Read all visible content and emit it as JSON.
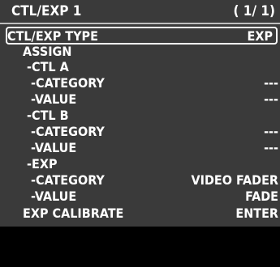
{
  "header": {
    "title": "CTL/EXP 1",
    "page": "( 1/ 1)"
  },
  "rows": [
    {
      "label": "CTL/EXP TYPE",
      "value": "EXP"
    },
    {
      "label": "ASSIGN",
      "value": ""
    },
    {
      "label": " -CTL A",
      "value": ""
    },
    {
      "label": "  -CATEGORY",
      "value": "---"
    },
    {
      "label": "  -VALUE",
      "value": "---"
    },
    {
      "label": " -CTL B",
      "value": ""
    },
    {
      "label": "  -CATEGORY",
      "value": "---"
    },
    {
      "label": "  -VALUE",
      "value": "---"
    },
    {
      "label": " -EXP",
      "value": ""
    },
    {
      "label": "  -CATEGORY",
      "value": "VIDEO FADER"
    },
    {
      "label": "  -VALUE",
      "value": "FADE"
    },
    {
      "label": "EXP CALIBRATE",
      "value": "ENTER"
    }
  ],
  "colors": {
    "background": "#3a3a3a",
    "text": "#ffffff",
    "selection_border": "#ffffff",
    "divider": "#bfbfbf"
  }
}
